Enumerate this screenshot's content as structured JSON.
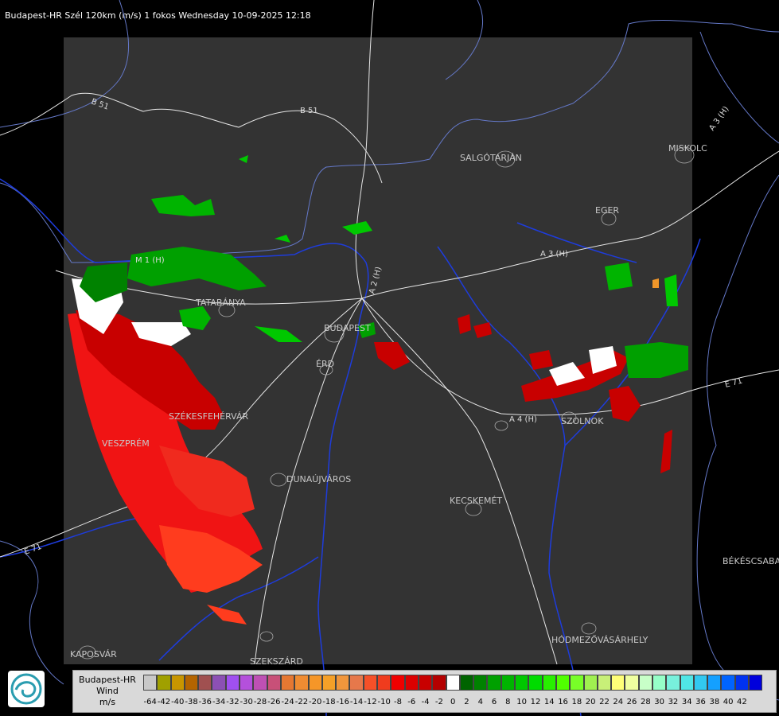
{
  "header": {
    "title": "Budapest-HR Szél 120km (m/s) 1 fokos Wednesday 10-09-2025 12:18"
  },
  "map": {
    "cities": [
      "SALGÓTARJÁN",
      "MISKOLC",
      "EGER",
      "TATABÁNYA",
      "BUDAPEST",
      "ÉRD",
      "SZÉKESFEHÉRVÁR",
      "VESZPRÉM",
      "DUNAÚJVÁROS",
      "KECSKEMÉT",
      "SZOLNOK",
      "BÉKÉSCSABA",
      "HÓDMEZŐVÁSÁRHELY",
      "KAPOSVÁR",
      "SZEKSZÁRD"
    ],
    "roads": [
      "B 51",
      "B 51",
      "A 3 (H)",
      "A 3 (H)",
      "M 1 (H)",
      "A 2 (H)",
      "A 4 (H)",
      "E 71",
      "E 71"
    ],
    "colors": {
      "background": "#000000",
      "coverage": "#333333",
      "rivers": "#1428c8",
      "borders": "#6478c8",
      "roads": "#e6e6e6"
    }
  },
  "legend": {
    "source": "Budapest-HR",
    "quantity": "Wind",
    "unit": "m/s",
    "colors": [
      "#c8c8c8",
      "#a0a000",
      "#c89600",
      "#b46400",
      "#a05050",
      "#8c50b4",
      "#a050f0",
      "#b450dc",
      "#be50b4",
      "#c85078",
      "#e67832",
      "#f08c32",
      "#f59628",
      "#f5a028",
      "#f0963c",
      "#e6784b",
      "#f55028",
      "#f03c1e",
      "#f00000",
      "#dc0000",
      "#c80000",
      "#b40000",
      "#ffffff",
      "#006400",
      "#008200",
      "#00a000",
      "#00b400",
      "#00c800",
      "#00dc00",
      "#28f000",
      "#50ff00",
      "#78ff28",
      "#a0f050",
      "#c8f078",
      "#ffff78",
      "#f0ffa0",
      "#c8ffc8",
      "#96ffc8",
      "#78f0dc",
      "#50e6e6",
      "#32c8f0",
      "#14a0ff",
      "#0064ff",
      "#0032f0",
      "#0000dc"
    ],
    "ticks": [
      "-64",
      "-42",
      "-40",
      "-38",
      "-36",
      "-34",
      "-32",
      "-30",
      "-28",
      "-26",
      "-24",
      "-22",
      "-20",
      "-18",
      "-16",
      "-14",
      "-12",
      "-10",
      "-8",
      "-6",
      "-4",
      "-2",
      "0",
      "2",
      "4",
      "6",
      "8",
      "10",
      "12",
      "14",
      "16",
      "18",
      "20",
      "22",
      "24",
      "26",
      "28",
      "30",
      "32",
      "34",
      "36",
      "38",
      "40",
      "42"
    ]
  }
}
